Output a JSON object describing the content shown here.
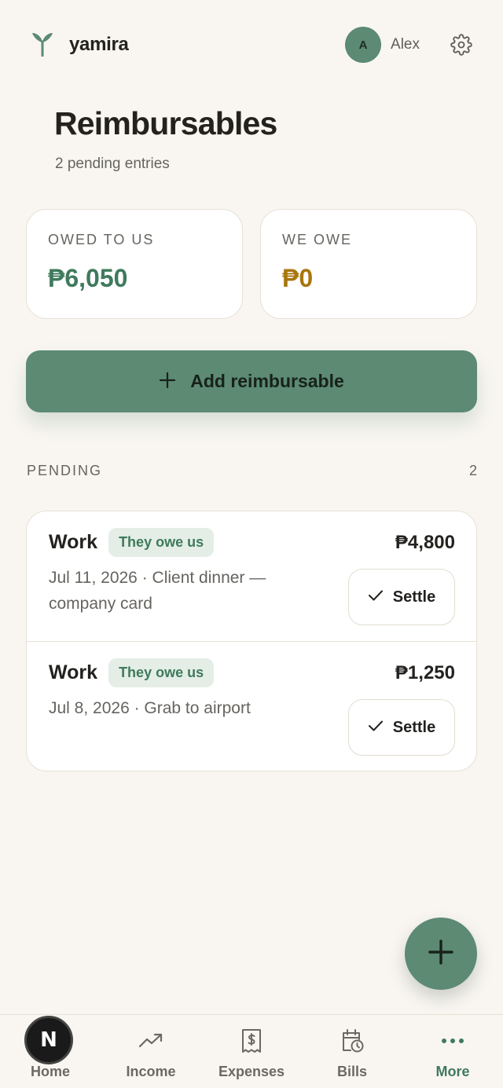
{
  "app": {
    "brand": "yamira"
  },
  "user": {
    "initial": "A",
    "name": "Alex"
  },
  "page": {
    "title": "Reimbursables",
    "subtitle": "2 pending entries"
  },
  "summary": {
    "owed_to_us": {
      "label": "OWED TO US",
      "value": "₱6,050"
    },
    "we_owe": {
      "label": "WE OWE",
      "value": "₱0"
    }
  },
  "actions": {
    "add_label": "Add reimbursable"
  },
  "pending": {
    "title": "PENDING",
    "count": "2",
    "items": [
      {
        "category": "Work",
        "badge": "They owe us",
        "amount": "₱4,800",
        "description": "Jul 11, 2026 · Client dinner — company card",
        "settle_label": "Settle"
      },
      {
        "category": "Work",
        "badge": "They owe us",
        "amount": "₱1,250",
        "description": "Jul 8, 2026 · Grab to airport",
        "settle_label": "Settle"
      }
    ]
  },
  "nav": {
    "items": [
      {
        "label": "Home",
        "icon": "home-icon"
      },
      {
        "label": "Income",
        "icon": "trending-up-icon"
      },
      {
        "label": "Expenses",
        "icon": "receipt-icon"
      },
      {
        "label": "Bills",
        "icon": "calendar-clock-icon"
      },
      {
        "label": "More",
        "icon": "more-dots-icon"
      }
    ],
    "active": "More"
  },
  "overlay": {
    "badge_letter": "N"
  },
  "colors": {
    "accent": "#5c8a72",
    "accent_text": "#3f7a5c",
    "amber": "#a8760e",
    "background": "#f9f6f1"
  }
}
